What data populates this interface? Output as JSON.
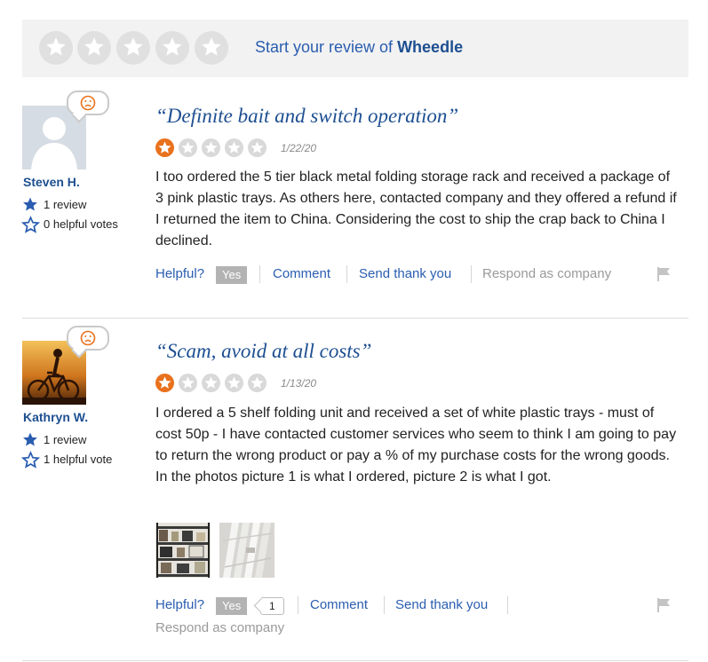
{
  "start_review": {
    "prefix": "Start your review of ",
    "company": "Wheedle",
    "stars": [
      "star-1",
      "star-2",
      "star-3",
      "star-4",
      "star-5"
    ]
  },
  "reviews": [
    {
      "reviewer": {
        "name": "Steven H.",
        "review_count": "1 review",
        "helpful_votes": "0 helpful votes",
        "mood_icon": "sad-face-icon"
      },
      "title": "“Definite bait and switch operation”",
      "rating": 1,
      "max_rating": 5,
      "date": "1/22/20",
      "body": [
        "I too ordered the 5 tier black metal folding storage rack and received a package of 3 pink plastic trays. As others here, contacted company and they offered a refund if I returned the item to China. Considering the cost to ship the crap back to China I declined."
      ],
      "actions": {
        "helpful": "Helpful?",
        "yes": "Yes",
        "comment": "Comment",
        "thank": "Send thank you",
        "respond": "Respond as company"
      }
    },
    {
      "reviewer": {
        "name": "Kathryn W.",
        "review_count": "1 review",
        "helpful_votes": "1 helpful vote",
        "mood_icon": "sad-face-icon"
      },
      "title": "“Scam, avoid at all costs”",
      "rating": 1,
      "max_rating": 5,
      "date": "1/13/20",
      "body": [
        "I ordered a 5 shelf folding unit and received a set of white plastic trays - must of cost 50p - I have contacted customer services who seem to think I am going to pay to return the wrong product or pay a % of my purchase costs for the wrong goods.",
        "In the photos picture 1 is what I ordered, picture 2 is what I got."
      ],
      "photos": [
        "photo-1",
        "photo-2"
      ],
      "actions": {
        "helpful": "Helpful?",
        "yes": "Yes",
        "yes_count": "1",
        "comment": "Comment",
        "thank": "Send thank you",
        "respond": "Respond as company"
      }
    }
  ],
  "colors": {
    "brand_blue": "#1d4f91",
    "link_blue": "#2a5db0",
    "rating_orange": "#e9711c",
    "star_gray": "#d9d9d9"
  }
}
